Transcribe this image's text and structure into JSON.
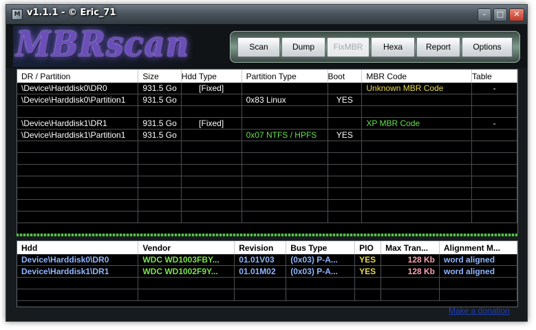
{
  "window": {
    "title": "v1.1.1 - © Eric_71"
  },
  "logo": {
    "text": "MBRscan"
  },
  "toolbar": {
    "buttons": [
      {
        "label": "Scan"
      },
      {
        "label": "Dump"
      },
      {
        "label": "FixMBR"
      },
      {
        "label": "Hexa"
      },
      {
        "label": "Report"
      },
      {
        "label": "Options"
      }
    ]
  },
  "partitions": {
    "headers": [
      "DR / Partition",
      "Size",
      "Hdd Type",
      "Partition Type",
      "Boot",
      "MBR Code",
      "Table"
    ],
    "rows": [
      [
        "\\Device\\Harddisk0\\DR0",
        "931.5 Go",
        "[Fixed]",
        "",
        "",
        "Unknown MBR Code",
        "-"
      ],
      [
        "\\Device\\Harddisk0\\Partition1",
        "931.5 Go",
        "",
        "0x83 Linux",
        "YES",
        "",
        ""
      ],
      [
        "",
        "",
        "",
        "",
        "",
        "",
        ""
      ],
      [
        "\\Device\\Harddisk1\\DR1",
        "931.5 Go",
        "[Fixed]",
        "",
        "",
        "XP MBR Code",
        "-"
      ],
      [
        "\\Device\\Harddisk1\\Partition1",
        "931.5 Go",
        "",
        "0x07 NTFS / HPFS",
        "YES",
        "",
        ""
      ],
      [
        "",
        "",
        "",
        "",
        "",
        "",
        ""
      ],
      [
        "",
        "",
        "",
        "",
        "",
        "",
        ""
      ],
      [
        "",
        "",
        "",
        "",
        "",
        "",
        ""
      ],
      [
        "",
        "",
        "",
        "",
        "",
        "",
        ""
      ],
      [
        "",
        "",
        "",
        "",
        "",
        "",
        ""
      ],
      [
        "",
        "",
        "",
        "",
        "",
        "",
        ""
      ],
      [
        "",
        "",
        "",
        "",
        "",
        "",
        ""
      ]
    ]
  },
  "disks": {
    "headers": [
      "Hdd",
      "Vendor",
      "Revision",
      "Bus Type",
      "PIO",
      "Max Tran...",
      "Alignment M..."
    ],
    "rows": [
      [
        "Device\\Harddisk0\\DR0",
        "WDC WD1003FBY...",
        "01.01V03",
        "(0x03)  P-A...",
        "YES",
        "128 Kb",
        "word aligned"
      ],
      [
        "Device\\Harddisk1\\DR1",
        "WDC WD1002F9Y...",
        "01.01M02",
        "(0x03)  P-A...",
        "YES",
        "128 Kb",
        "word aligned"
      ],
      [
        "",
        "",
        "",
        "",
        "",
        "",
        ""
      ],
      [
        "",
        "",
        "",
        "",
        "",
        "",
        ""
      ]
    ]
  },
  "footer": {
    "donate_link": "Make a donation"
  },
  "colors": {
    "unknown_mbr": "#e7d94a",
    "xp_mbr": "#63e24a",
    "device_text": "#8fb6ff",
    "vendor_text": "#7ae34c",
    "transfer_text": "#f7a3b0"
  }
}
